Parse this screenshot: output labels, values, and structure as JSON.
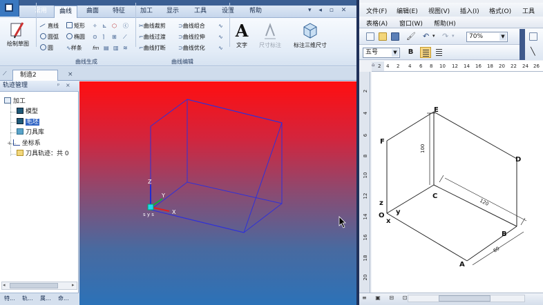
{
  "cad": {
    "tabs": [
      "常用",
      "曲线",
      "曲面",
      "特征",
      "加工",
      "显示",
      "工具",
      "设置",
      "帮助"
    ],
    "active_tab": "曲线",
    "ribbon": {
      "sketch_label": "绘制草图",
      "curve_gen": {
        "items": [
          "直线",
          "矩形",
          "圆弧",
          "椭圆",
          "圆",
          "样条",
          "fm"
        ],
        "group_label": "曲线生成"
      },
      "curve_edit": {
        "items": [
          "曲线裁剪",
          "曲线组合",
          "曲线过渡",
          "曲线拉伸",
          "曲线打断",
          "曲线优化"
        ],
        "group_label": "曲线编辑"
      },
      "text_label": "文字",
      "text_glyph": "A",
      "dim_label": "尺寸标注",
      "dim3d_label": "标注三维尺寸"
    },
    "doc_tab": "制造2",
    "doc_close": "×",
    "tree": {
      "title": "轨迹管理",
      "pin": "ᵖ ×",
      "root": "加工",
      "items": [
        "模型",
        "毛坯",
        "刀具库",
        "坐标系",
        "刀具轨迹：共 0"
      ]
    },
    "bottom_tabs": [
      "特...",
      "轨...",
      "属...",
      "命..."
    ],
    "triad": {
      "z": "Z",
      "y": "Y",
      "x": "X",
      "sys": "s y s"
    },
    "colors": {
      "viewport_top": "#ff0e10",
      "viewport_bottom": "#2c72b8",
      "wireframe": "#2f31d8",
      "selection": "#3064c4"
    }
  },
  "word": {
    "menu1": [
      "文件(F)",
      "编辑(E)",
      "视图(V)",
      "插入(I)",
      "格式(O)",
      "工具"
    ],
    "menu2": [
      "表格(A)",
      "窗口(W)",
      "帮助(H)"
    ],
    "zoom": "70%",
    "font_size": "五号",
    "bold": "B",
    "ruler_marks": [
      "2",
      "4",
      "2",
      "4",
      "6",
      "8",
      "10",
      "12",
      "14",
      "16",
      "18",
      "20",
      "22",
      "24",
      "26"
    ],
    "vruler_marks": [
      "2",
      "4",
      "6",
      "8",
      "10",
      "12",
      "14",
      "16",
      "18",
      "20"
    ],
    "drawing": {
      "vertices": [
        "E",
        "F",
        "D",
        "C",
        "B",
        "A",
        "O"
      ],
      "axes": {
        "z": "z",
        "y": "y",
        "x": "x"
      },
      "dimensions": {
        "height": "100",
        "length": "120",
        "depth": "80"
      }
    }
  }
}
